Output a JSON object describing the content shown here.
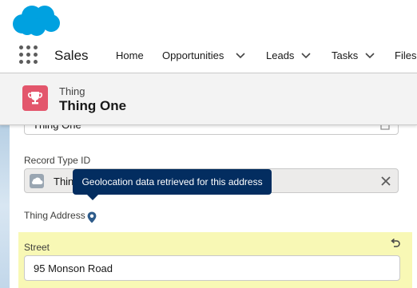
{
  "header": {
    "logo_icon": "cloud-logo-icon",
    "brand_color": "#00a1e0"
  },
  "nav": {
    "app_name": "Sales",
    "items": [
      {
        "label": "Home",
        "has_menu": false
      },
      {
        "label": "Opportunities",
        "has_menu": true
      },
      {
        "label": "Leads",
        "has_menu": true
      },
      {
        "label": "Tasks",
        "has_menu": true
      },
      {
        "label": "Files",
        "has_menu": false
      }
    ]
  },
  "record": {
    "object_label": "Thing",
    "title": "Thing One",
    "icon": "trophy-icon",
    "icon_color": "#e3566c"
  },
  "form": {
    "name_value": "Thing One",
    "record_type_label": "Record Type ID",
    "record_type_value": "Thin",
    "address_label": "Thing Address",
    "tooltip_text": "Geolocation data retrieved for this address",
    "street_label": "Street",
    "street_value": "95 Monson Road",
    "highlight_color": "#f8f8b5"
  }
}
